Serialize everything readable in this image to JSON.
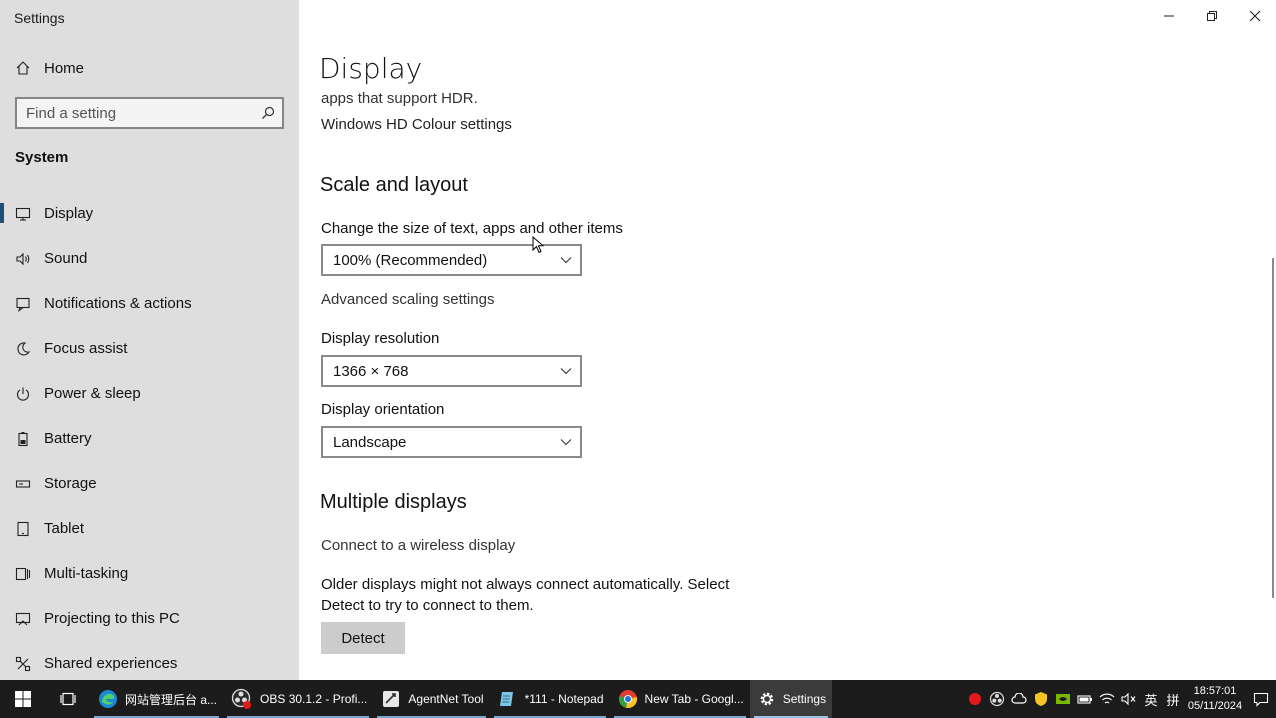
{
  "window": {
    "app_title": "Settings"
  },
  "sidebar": {
    "home_label": "Home",
    "search_placeholder": "Find a setting",
    "section_label": "System",
    "items": [
      {
        "label": "Display",
        "icon": "monitor-icon",
        "selected": true
      },
      {
        "label": "Sound",
        "icon": "speaker-icon"
      },
      {
        "label": "Notifications & actions",
        "icon": "notification-icon"
      },
      {
        "label": "Focus assist",
        "icon": "moon-icon"
      },
      {
        "label": "Power & sleep",
        "icon": "power-icon"
      },
      {
        "label": "Battery",
        "icon": "battery-icon"
      },
      {
        "label": "Storage",
        "icon": "storage-icon"
      },
      {
        "label": "Tablet",
        "icon": "tablet-icon"
      },
      {
        "label": "Multi-tasking",
        "icon": "multitasking-icon"
      },
      {
        "label": "Projecting to this PC",
        "icon": "projecting-icon"
      },
      {
        "label": "Shared experiences",
        "icon": "shared-icon"
      }
    ]
  },
  "main": {
    "page_title": "Display",
    "hdr_text": "apps that support HDR.",
    "hdr_link": "Windows HD Colour settings",
    "scale_section": {
      "heading": "Scale and layout",
      "scale_label": "Change the size of text, apps and other items",
      "scale_value": "100% (Recommended)",
      "advanced_link": "Advanced scaling settings",
      "resolution_label": "Display resolution",
      "resolution_value": "1366 × 768",
      "orientation_label": "Display orientation",
      "orientation_value": "Landscape"
    },
    "multiple_section": {
      "heading": "Multiple displays",
      "wireless_link": "Connect to a wireless display",
      "older_text": "Older displays might not always connect automatically. Select Detect to try to connect to them.",
      "detect_button": "Detect"
    }
  },
  "taskbar": {
    "apps": [
      {
        "label": "网站管理后台 a...",
        "icon": "edge-icon"
      },
      {
        "label": "OBS 30.1.2 - Profi...",
        "icon": "obs-icon"
      },
      {
        "label": "AgentNet Tool",
        "icon": "agentnet-icon"
      },
      {
        "label": "*111 - Notepad",
        "icon": "notepad-icon"
      },
      {
        "label": "New Tab - Googl...",
        "icon": "chrome-icon"
      },
      {
        "label": "Settings",
        "icon": "gear-icon",
        "active": true
      }
    ],
    "tray": {
      "ime_label": "英",
      "ime_mode": "拼",
      "time": "18:57:01",
      "date": "05/11/2024"
    }
  },
  "colors": {
    "sidebar_bg": "#dedede",
    "taskbar_bg": "#1c1c1c",
    "accent": "#1f4e7a"
  }
}
